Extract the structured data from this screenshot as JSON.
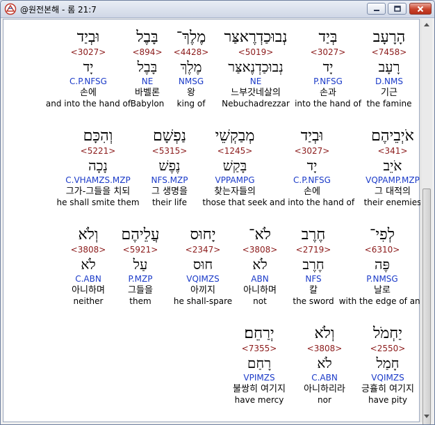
{
  "window": {
    "title": "@원전본해 - 롬 21:7",
    "buttons": {
      "minimize": "minimize",
      "maximize": "maximize",
      "close": "close"
    }
  },
  "rows": [
    [
      {
        "hebrew": "הָרָעָב",
        "strong": "<7458>",
        "lemma": "רָעָב",
        "parse": "D.NMS",
        "korean": "기근",
        "english": "the famine"
      },
      {
        "hebrew": "בְּיַד",
        "strong": "<3027>",
        "lemma": "יָד",
        "parse": "P.NFSG",
        "korean": "손과",
        "english": "into the hand of"
      },
      {
        "hebrew": "נְבוּכַדְרֶאצַּר",
        "strong": "<5019>",
        "lemma": "נְבוּכַדְנֶאצַּר",
        "parse": "NE",
        "korean": "느부갓네살의",
        "english": "Nebuchadrezzar"
      },
      {
        "hebrew": "מֶלֶךְ־",
        "strong": "<4428>",
        "lemma": "מֶלֶךְ",
        "parse": "NMSG",
        "korean": "왕",
        "english": "king of"
      },
      {
        "hebrew": "בָּבֶל",
        "strong": "<894>",
        "lemma": "בָּבֶל",
        "parse": "NE",
        "korean": "바벨론",
        "english": "Babylon"
      },
      {
        "hebrew": "וּבְיַד",
        "strong": "<3027>",
        "lemma": "יָד",
        "parse": "C.P.NFSG",
        "korean": "손에",
        "english": "and into the hand of"
      }
    ],
    [
      {
        "hebrew": "אֹיְבֵיהֶם",
        "strong": "<341>",
        "lemma": "אֹיֵב",
        "parse": "VQPAMP.MZP",
        "korean": "그 대적의",
        "english": "their enemies"
      },
      {
        "hebrew": "וּבְיַד",
        "strong": "<3027>",
        "lemma": "יָד",
        "parse": "C.P.NFSG",
        "korean": "손에",
        "english": "and into the hand of"
      },
      {
        "hebrew": "מְבַקְשֵׁי",
        "strong": "<1245>",
        "lemma": "בָּקַשׁ",
        "parse": "VPPAMPG",
        "korean": "찾는자들의",
        "english": "those that seek"
      },
      {
        "hebrew": "נַפְשָׁם",
        "strong": "<5315>",
        "lemma": "נֶפֶשׁ",
        "parse": "NFS.MZP",
        "korean": "그 생명을",
        "english": "their life"
      },
      {
        "hebrew": "וְהִכָּם",
        "strong": "<5221>",
        "lemma": "נָכָה",
        "parse": "C.VHAMZS.MZP",
        "korean": "그가-그들을 치되",
        "english": "he shall smite them"
      }
    ],
    [
      {
        "hebrew": "לְפִי־",
        "strong": "<6310>",
        "lemma": "פֶּה",
        "parse": "P.NMSG",
        "korean": "날로",
        "english": "with the edge of and"
      },
      {
        "hebrew": "חֶרֶב",
        "strong": "<2719>",
        "lemma": "חֶרֶב",
        "parse": "NFS",
        "korean": "칼",
        "english": "the sword"
      },
      {
        "hebrew": "לֹא־",
        "strong": "<3808>",
        "lemma": "לֹא",
        "parse": "ABN",
        "korean": "아니하며",
        "english": "not"
      },
      {
        "hebrew": "יָחוּס",
        "strong": "<2347>",
        "lemma": "חוּס",
        "parse": "VQIMZS",
        "korean": "아끼지",
        "english": "he shall-spare"
      },
      {
        "hebrew": "עֲלֵיהֶם",
        "strong": "<5921>",
        "lemma": "עַל",
        "parse": "P.MZP",
        "korean": "그들을",
        "english": "them"
      },
      {
        "hebrew": "וְלֹא",
        "strong": "<3808>",
        "lemma": "לֹא",
        "parse": "C.ABN",
        "korean": "아니하며",
        "english": "neither"
      }
    ],
    [
      {
        "hebrew": "יַחְמֹל",
        "strong": "<2550>",
        "lemma": "חָמַל",
        "parse": "VQIMZS",
        "korean": "긍휼히 여기지",
        "english": "have pity"
      },
      {
        "hebrew": "וְלֹא",
        "strong": "<3808>",
        "lemma": "לֹא",
        "parse": "C.ABN",
        "korean": "아니하리라",
        "english": "nor"
      },
      {
        "hebrew": "יְרַחֵם׃",
        "strong": "<7355>",
        "lemma": "רָחַם",
        "parse": "VPIMZS",
        "korean": "불쌍히 여기지",
        "english": "have mercy"
      }
    ]
  ]
}
